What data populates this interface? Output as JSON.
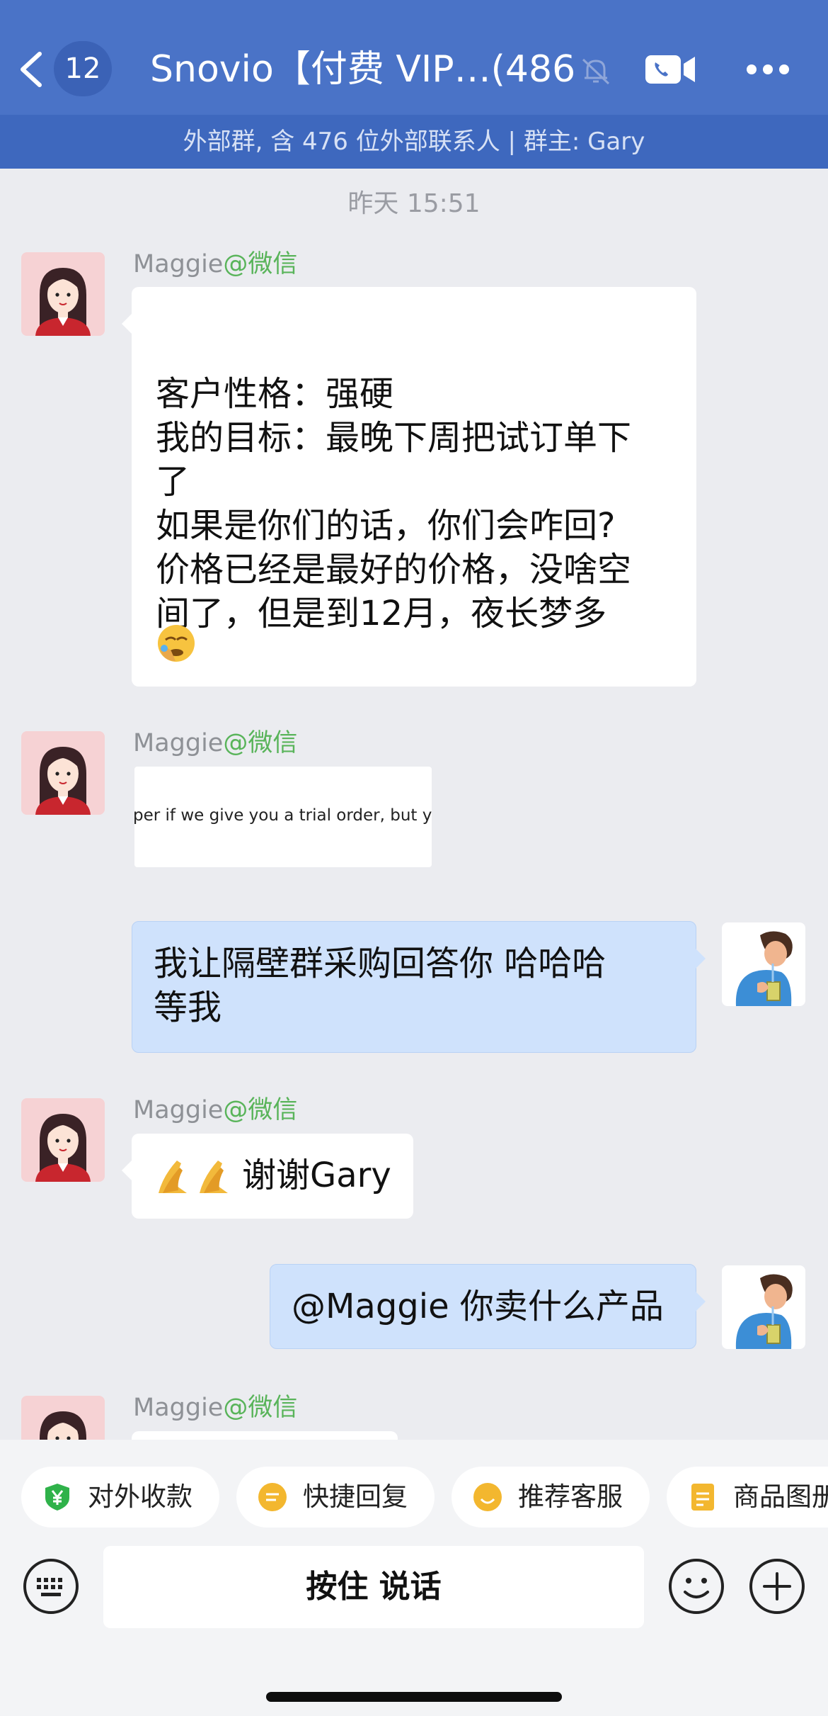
{
  "header": {
    "back_badge": "12",
    "title": "Snovio【付费 VIP…(486)",
    "subtitle": "外部群, 含 476 位外部联系人 | 群主: Gary",
    "icons": [
      "back-chevron-icon",
      "unread-count-badge",
      "mute-bell-icon",
      "video-call-icon",
      "more-dots-icon"
    ]
  },
  "chat": {
    "timestamp": "昨天 15:51",
    "messages": [
      {
        "sender": "Maggie",
        "sender_source": "@微信",
        "direction": "incoming",
        "lines": [
          "",
          "客户性格：强硬",
          "我的目标：最晚下周把试订单下",
          "了",
          "如果是你们的话，你们会咋回?",
          "价格已经是最好的价格，没啥空",
          "间了，但是到12月，夜长梦多"
        ],
        "trailing_emoji": "facepalm-emoji"
      },
      {
        "sender": "Maggie",
        "sender_source": "@微信",
        "direction": "incoming",
        "type": "image",
        "image_text": "per if we give you a trial order, but yo"
      },
      {
        "direction": "outgoing",
        "lines": [
          "我让隔壁群采购回答你 哈哈哈",
          "等我"
        ]
      },
      {
        "sender": "Maggie",
        "sender_source": "@微信",
        "direction": "incoming",
        "emoji_prefix": "folded-hands-emoji",
        "text": "谢谢Gary"
      },
      {
        "direction": "outgoing",
        "text": "@Maggie 你卖什么产品"
      },
      {
        "sender": "Maggie",
        "sender_source": "@微信",
        "direction": "incoming",
        "partial": true
      }
    ]
  },
  "quick_bar": {
    "chips": [
      {
        "label": "对外收款",
        "icon": "payment-icon",
        "color": "#2FB24A"
      },
      {
        "label": "快捷回复",
        "icon": "quick-reply-icon",
        "color": "#F3B72F"
      },
      {
        "label": "推荐客服",
        "icon": "recommend-service-icon",
        "color": "#F3B72F"
      },
      {
        "label": "商品图册",
        "icon": "product-album-icon",
        "color": "#F3B72F"
      }
    ]
  },
  "input_bar": {
    "talk_label": "按住 说话",
    "icons": [
      "keyboard-icon",
      "emoji-icon",
      "plus-icon"
    ]
  },
  "colors": {
    "header_bg": "#4A73C7",
    "subheader_bg": "#3E68BE",
    "chat_bg": "#EBECF0",
    "incoming_bubble": "#FFFFFF",
    "outgoing_bubble": "#CFE2FC",
    "source_green": "#59B45A"
  }
}
